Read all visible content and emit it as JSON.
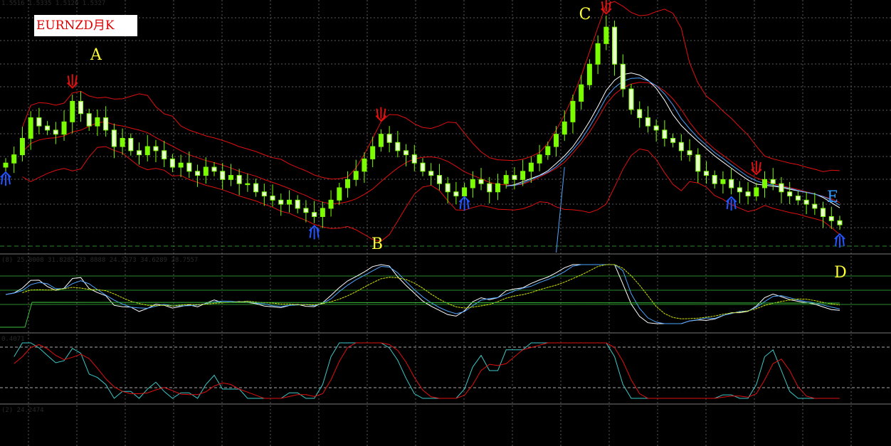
{
  "chart_title": "EURNZD月K",
  "ohlc_readout": "1.5516 1.5335 1.5126 1.5327",
  "indicator1_readout": "(8) 25.8008 31.8285 33.8888 24.2173 34.6289 28.7557",
  "indicator2_readout": "0.4071",
  "indicator3_readout": "(2) 24.2474",
  "colors": {
    "background": "#000000",
    "grid": "#5a5a5a",
    "candle": "#7CFC00",
    "bollinger": "#e01010",
    "ma_white": "#ffffff",
    "ma_blue": "#4da3ff",
    "signal_yellow": "#d4e600",
    "stoch_red": "#e01010",
    "stoch_cyan": "#3cc8c8",
    "point_labels": "#ffff33",
    "point_label_e": "#3399ff",
    "arrow_up": "#e01010",
    "arrow_down": "#2255ff"
  },
  "chart_data": {
    "type": "candlestick",
    "title": "EURNZD月K",
    "symbol": "EURNZD",
    "timeframe": "月K",
    "price_path": [
      1.75,
      1.77,
      1.81,
      1.86,
      1.84,
      1.83,
      1.82,
      1.85,
      1.9,
      1.87,
      1.84,
      1.86,
      1.83,
      1.79,
      1.81,
      1.78,
      1.77,
      1.79,
      1.78,
      1.76,
      1.74,
      1.75,
      1.73,
      1.72,
      1.74,
      1.73,
      1.71,
      1.72,
      1.7,
      1.7,
      1.68,
      1.67,
      1.66,
      1.65,
      1.66,
      1.64,
      1.63,
      1.62,
      1.64,
      1.66,
      1.69,
      1.71,
      1.73,
      1.76,
      1.79,
      1.82,
      1.8,
      1.78,
      1.77,
      1.75,
      1.73,
      1.72,
      1.7,
      1.68,
      1.67,
      1.69,
      1.71,
      1.7,
      1.68,
      1.7,
      1.72,
      1.71,
      1.73,
      1.75,
      1.77,
      1.79,
      1.82,
      1.85,
      1.9,
      1.94,
      1.99,
      2.04,
      2.08,
      1.99,
      1.93,
      1.88,
      1.86,
      1.84,
      1.83,
      1.81,
      1.8,
      1.78,
      1.77,
      1.73,
      1.72,
      1.7,
      1.71,
      1.69,
      1.68,
      1.67,
      1.69,
      1.71,
      1.7,
      1.68,
      1.67,
      1.66,
      1.65,
      1.64,
      1.62,
      1.61,
      1.6
    ],
    "marked_points": [
      {
        "label": "A",
        "index": 8
      },
      {
        "label": "B",
        "index": 37
      },
      {
        "label": "C",
        "index": 72
      },
      {
        "label": "D",
        "index": 100
      },
      {
        "label": "E",
        "index": 98
      }
    ],
    "top_arrow_indices": [
      8,
      45,
      72,
      90
    ],
    "bottom_arrow_indices": [
      0,
      37,
      55,
      87,
      100
    ],
    "overlays": [
      "bollinger_upper",
      "bollinger_lower",
      "bollinger_middle",
      "ma_white",
      "ma_blue"
    ],
    "sub_indicators": [
      {
        "name": "oscillator",
        "series": [
          "white",
          "blue",
          "yellow",
          "green"
        ],
        "readout": "(8) 25.8008 31.8285 33.8888 24.2173 34.6289 28.7557"
      },
      {
        "name": "stochastic",
        "series": [
          "red",
          "cyan"
        ],
        "readout": "0.4071"
      }
    ],
    "grid": true
  }
}
